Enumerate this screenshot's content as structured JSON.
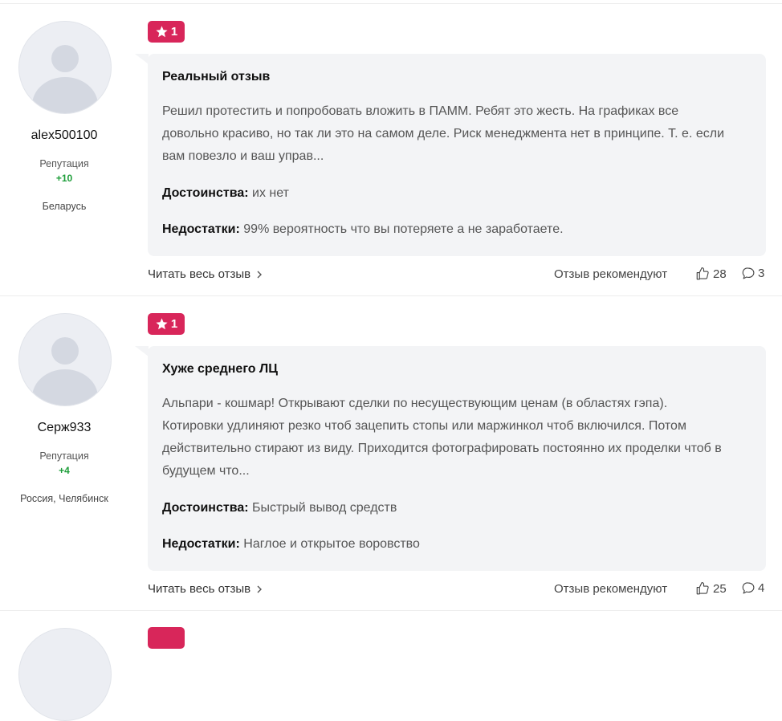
{
  "reviews": [
    {
      "username": "alex500100",
      "reputation_label": "Репутация",
      "reputation_value": "+10",
      "location": "Беларусь",
      "rating": "1",
      "title": "Реальный отзыв",
      "text": "Решил протестить и попробовать вложить в ПАММ. Ребят это жесть. На графиках все довольно красиво, но так ли это на самом деле. Риск менеджмента нет в принципе. Т. е. если вам повезло и ваш управ...",
      "pros_label": "Достоинства:",
      "pros": "их нет",
      "cons_label": "Недостатки:",
      "cons": "99% вероятность что вы потеряете а не заработаете.",
      "read_more": "Читать весь отзыв",
      "recommend_label": "Отзыв рекомендуют",
      "likes": "28",
      "comments": "3"
    },
    {
      "username": "Серж933",
      "reputation_label": "Репутация",
      "reputation_value": "+4",
      "location": "Россия, Челябинск",
      "rating": "1",
      "title": "Хуже среднего ЛЦ",
      "text": "Альпари - кошмар! Открывают сделки по несуществующим ценам (в областях гэпа). Котировки удлиняют резко чтоб зацепить стопы или маржинкол чтоб включился. Потом действительно стирают из виду. Приходится фотографировать постоянно их проделки чтоб в будущем что...",
      "pros_label": "Достоинства:",
      "pros": "Быстрый вывод средств",
      "cons_label": "Недостатки:",
      "cons": "Наглое и открытое воровство",
      "read_more": "Читать весь отзыв",
      "recommend_label": "Отзыв рекомендуют",
      "likes": "25",
      "comments": "4"
    }
  ],
  "colors": {
    "rating_badge": "#d8265a",
    "reputation_positive": "#1e9e3a",
    "bubble_background": "#f3f4f6"
  }
}
